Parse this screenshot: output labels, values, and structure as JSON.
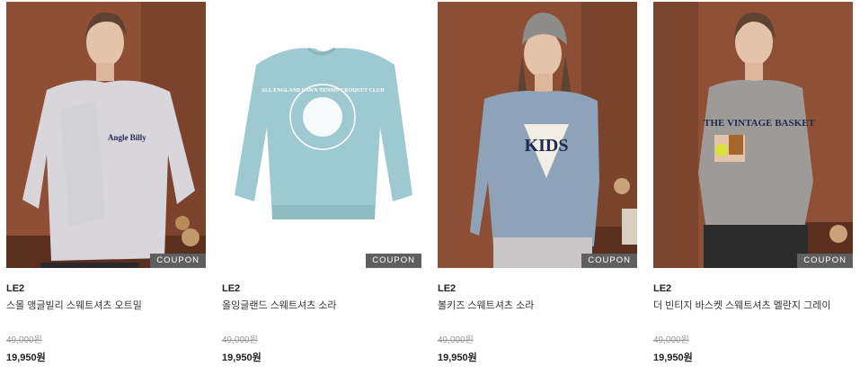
{
  "products": [
    {
      "brand": "LE2",
      "name": "스몰 앵글빌리 스웨트셔츠 오트밀",
      "original_price": "49,000원",
      "sale_price": "19,950원",
      "coupon": "COUPON",
      "chest_text": "Angle Billy"
    },
    {
      "brand": "LE2",
      "name": "올잉글랜드 스웨트셔츠 소라",
      "original_price": "49,000원",
      "sale_price": "19,950원",
      "coupon": "COUPON",
      "chest_text": "ALL ENGLAND LAWN TENNIS CROQUET CLUB"
    },
    {
      "brand": "LE2",
      "name": "볼키즈 스웨트셔츠 소라",
      "original_price": "49,000원",
      "sale_price": "19,950원",
      "coupon": "COUPON",
      "chest_text": "KIDS"
    },
    {
      "brand": "LE2",
      "name": "더 빈티지 바스켓 스웨트셔츠 멜란지 그레이",
      "original_price": "49,000원",
      "sale_price": "19,950원",
      "coupon": "COUPON",
      "chest_text": "THE VINTAGE BASKET"
    }
  ]
}
